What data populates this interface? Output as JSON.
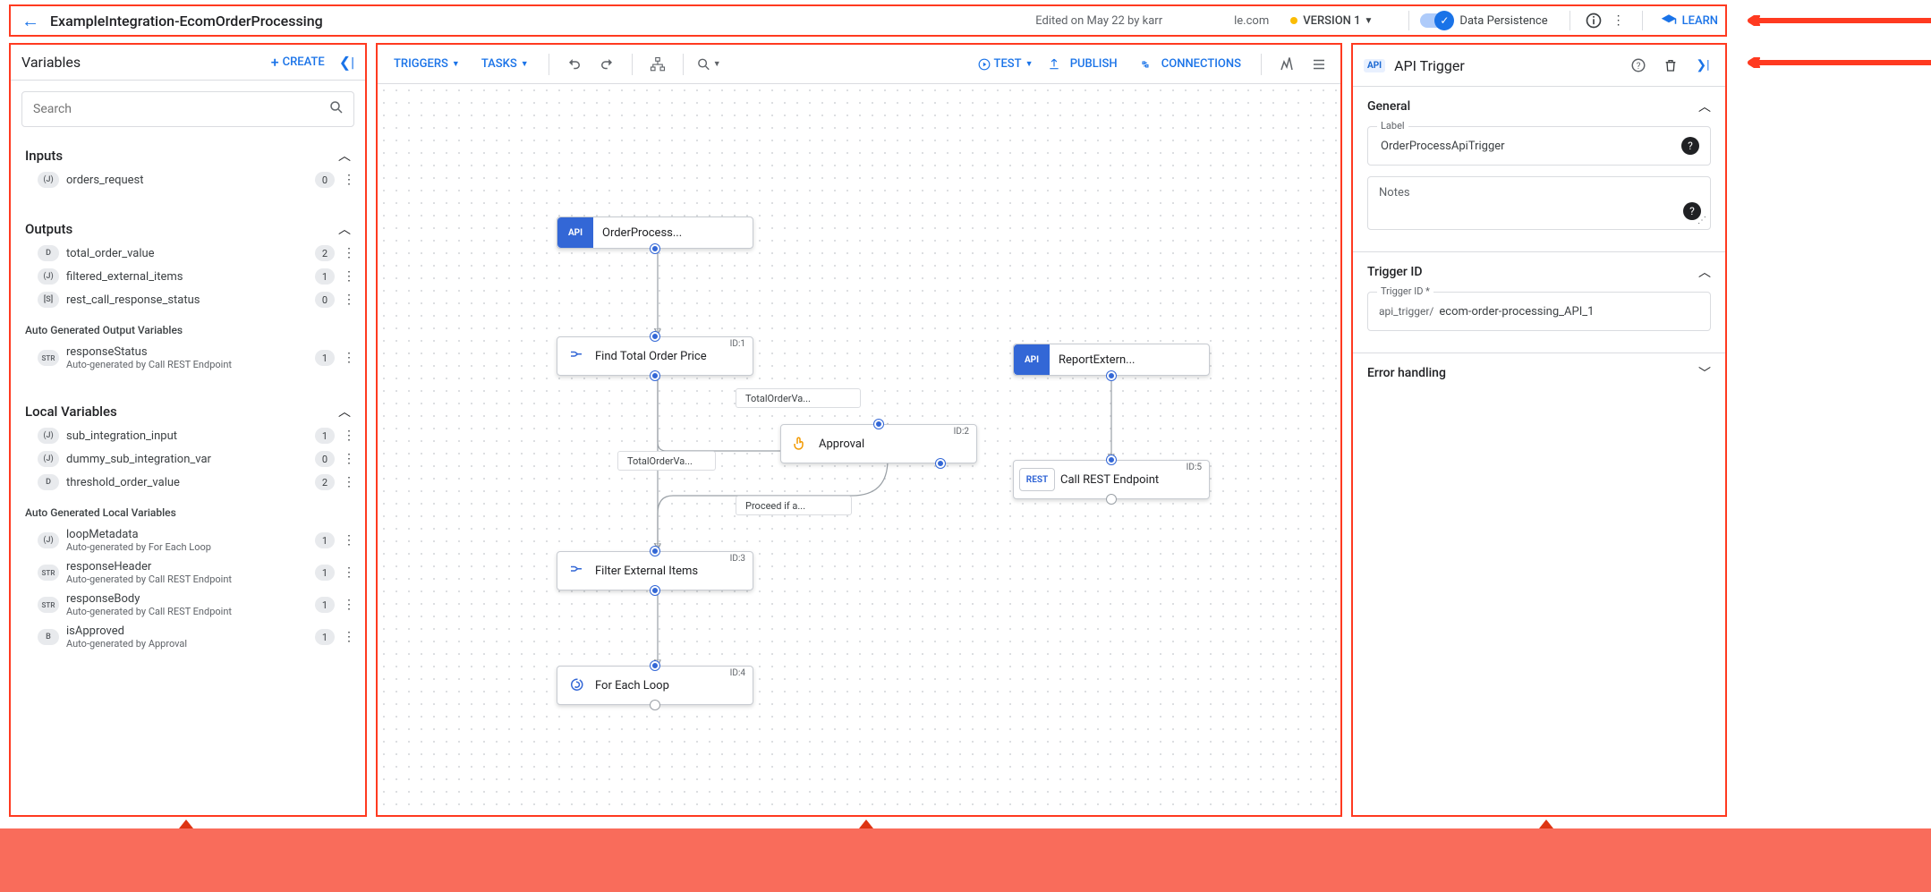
{
  "header": {
    "title": "ExampleIntegration-EcomOrderProcessing",
    "edited": "Edited on May 22 by karr",
    "domain": "le.com",
    "version": "VERSION 1",
    "persistence": "Data Persistence",
    "learn": "LEARN"
  },
  "left": {
    "title": "Variables",
    "create": "CREATE",
    "search_placeholder": "Search",
    "sections": {
      "inputs": {
        "title": "Inputs",
        "items": [
          {
            "type": "(J)",
            "name": "orders_request",
            "count": "0"
          }
        ]
      },
      "outputs": {
        "title": "Outputs",
        "items": [
          {
            "type": "D",
            "name": "total_order_value",
            "count": "2"
          },
          {
            "type": "(J)",
            "name": "filtered_external_items",
            "count": "1"
          },
          {
            "type": "[S]",
            "name": "rest_call_response_status",
            "count": "0"
          }
        ],
        "auto_title": "Auto Generated Output Variables",
        "auto_items": [
          {
            "type": "STR",
            "name": "responseStatus",
            "sub": "Auto-generated by Call REST Endpoint",
            "count": "1"
          }
        ]
      },
      "locals": {
        "title": "Local Variables",
        "items": [
          {
            "type": "(J)",
            "name": "sub_integration_input",
            "count": "1"
          },
          {
            "type": "(J)",
            "name": "dummy_sub_integration_var",
            "count": "0"
          },
          {
            "type": "D",
            "name": "threshold_order_value",
            "count": "2"
          }
        ],
        "auto_title": "Auto Generated Local Variables",
        "auto_items": [
          {
            "type": "(J)",
            "name": "loopMetadata",
            "sub": "Auto-generated by For Each Loop",
            "count": "1"
          },
          {
            "type": "STR",
            "name": "responseHeader",
            "sub": "Auto-generated by Call REST Endpoint",
            "count": "1"
          },
          {
            "type": "STR",
            "name": "responseBody",
            "sub": "Auto-generated by Call REST Endpoint",
            "count": "1"
          },
          {
            "type": "B",
            "name": "isApproved",
            "sub": "Auto-generated by Approval",
            "count": "1"
          }
        ]
      }
    }
  },
  "center": {
    "triggers": "TRIGGERS",
    "tasks": "TASKS",
    "test": "TEST",
    "publish": "PUBLISH",
    "connections": "CONNECTIONS",
    "nodes": {
      "n0": {
        "label": "OrderProcess..."
      },
      "n1": {
        "label": "Find Total Order Price",
        "id": "ID:1"
      },
      "n2": {
        "label": "Approval",
        "id": "ID:2"
      },
      "n3": {
        "label": "Filter External Items",
        "id": "ID:3"
      },
      "n4": {
        "label": "For Each Loop",
        "id": "ID:4"
      },
      "n5": {
        "label": "ReportExtern..."
      },
      "n6": {
        "label": "Call REST Endpoint",
        "id": "ID:5"
      }
    },
    "edges": {
      "e1": "TotalOrderVa...",
      "e2": "TotalOrderVa...",
      "e3": "Proceed if a..."
    }
  },
  "right": {
    "title": "API Trigger",
    "general": "General",
    "label_field": "Label",
    "label_value": "OrderProcessApiTrigger",
    "notes": "Notes",
    "trigger_sec": "Trigger ID",
    "trigger_label": "Trigger ID *",
    "trigger_prefix": "api_trigger/",
    "trigger_value": "ecom-order-processing_API_1",
    "error": "Error handling"
  }
}
